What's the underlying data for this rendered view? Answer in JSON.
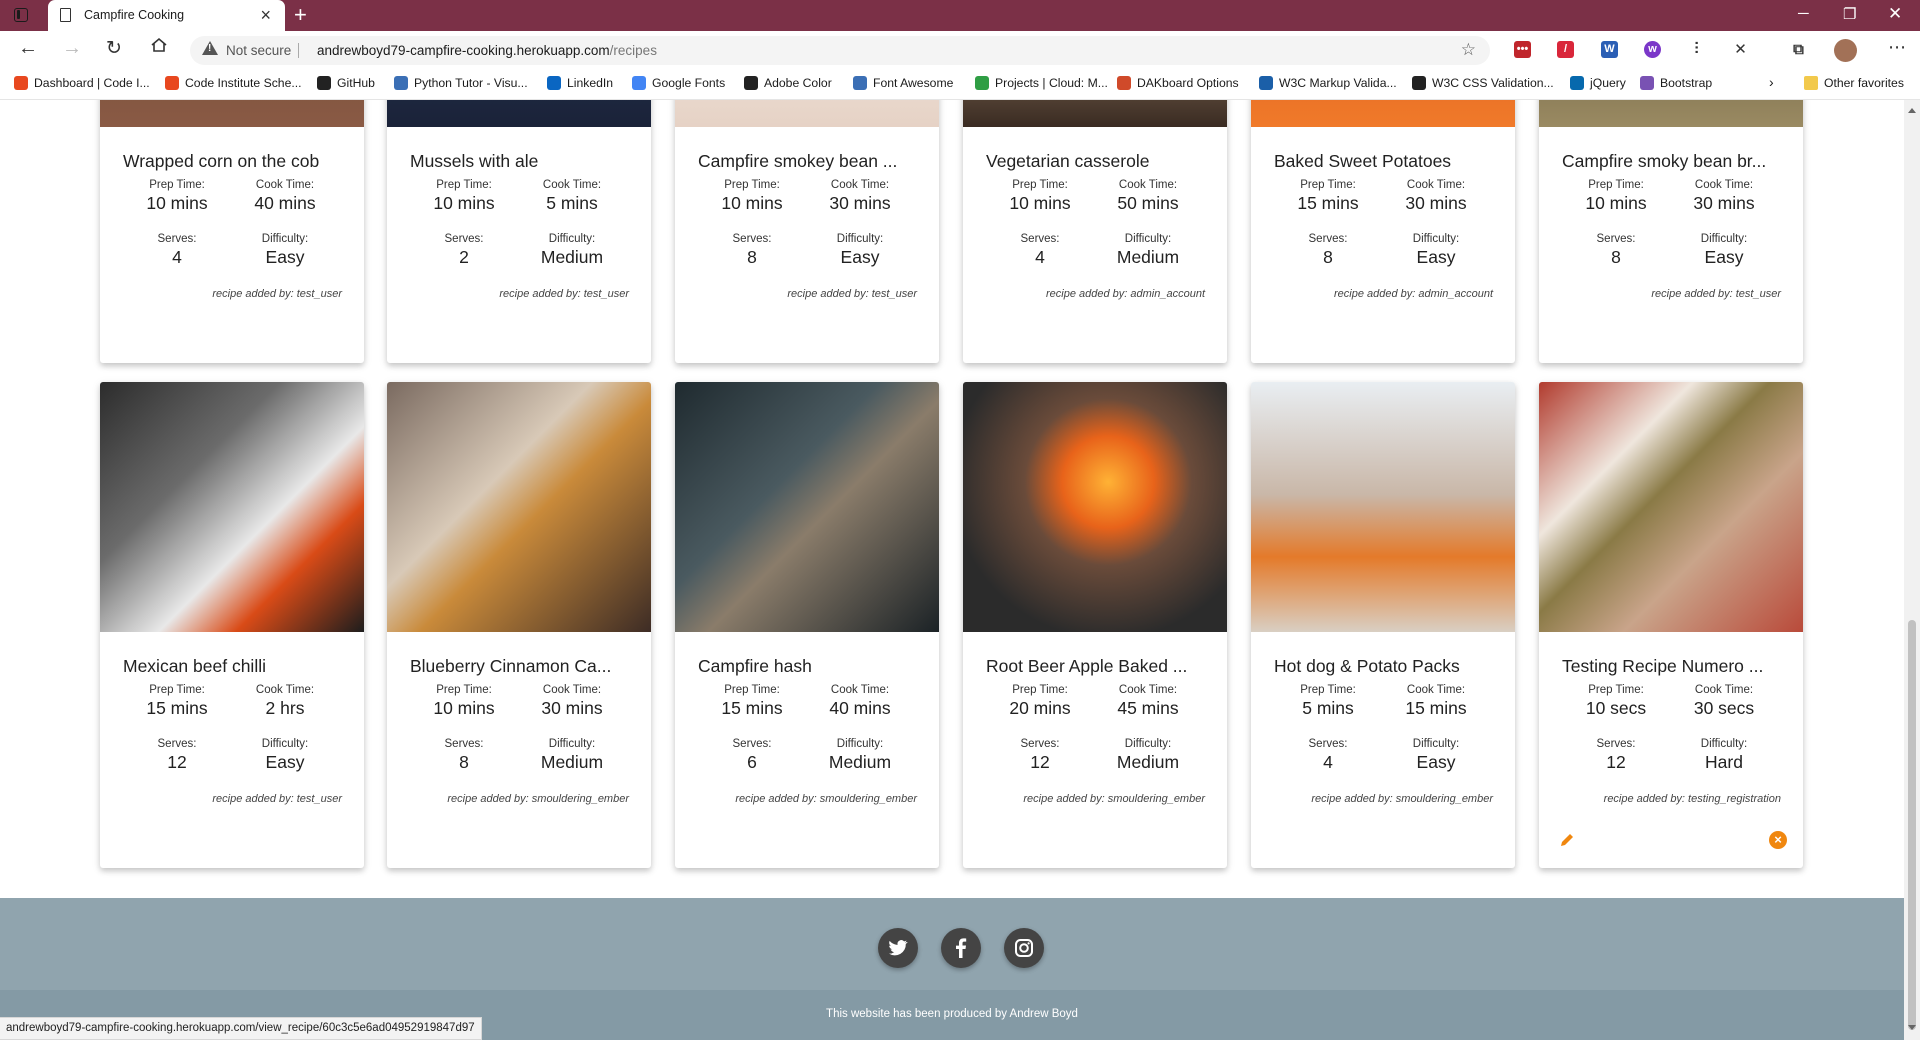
{
  "browser": {
    "tab_title": "Campfire Cooking",
    "not_secure": "Not secure",
    "url_host": "andrewboyd79-campfire-cooking.herokuapp.com",
    "url_path": "/recipes",
    "status_url": "andrewboyd79-campfire-cooking.herokuapp.com/view_recipe/60c3c5e6ad04952919847d97"
  },
  "bookmarks": [
    {
      "label": "Dashboard | Code I...",
      "color": "#e8481f"
    },
    {
      "label": "Code Institute Sche...",
      "color": "#e8481f"
    },
    {
      "label": "GitHub",
      "color": "#222222"
    },
    {
      "label": "Python Tutor - Visu...",
      "color": "#3b6fb5"
    },
    {
      "label": "LinkedIn",
      "color": "#0a66c2"
    },
    {
      "label": "Google Fonts",
      "color": "#4285f4"
    },
    {
      "label": "Adobe Color",
      "color": "#222222"
    },
    {
      "label": "Font Awesome",
      "color": "#3b6fb5"
    },
    {
      "label": "Projects | Cloud: M...",
      "color": "#2f9e44"
    },
    {
      "label": "DAKboard Options",
      "color": "#d04a2a"
    },
    {
      "label": "W3C Markup Valida...",
      "color": "#1b5fa8"
    },
    {
      "label": "W3C CSS Validation...",
      "color": "#222222"
    },
    {
      "label": "jQuery",
      "color": "#0769ad"
    },
    {
      "label": "Bootstrap",
      "color": "#7952b3"
    }
  ],
  "bookmarks_other": "Other favorites",
  "labels": {
    "prep": "Prep Time:",
    "cook": "Cook Time:",
    "serves": "Serves:",
    "difficulty": "Difficulty:"
  },
  "recipes_row1": [
    {
      "title": "Wrapped corn on the cob",
      "prep": "10 mins",
      "cook": "40 mins",
      "serves": "4",
      "difficulty": "Easy",
      "added_by": "recipe added by: test_user"
    },
    {
      "title": "Mussels with ale",
      "prep": "10 mins",
      "cook": "5 mins",
      "serves": "2",
      "difficulty": "Medium",
      "added_by": "recipe added by: test_user"
    },
    {
      "title": "Campfire smokey bean ...",
      "prep": "10 mins",
      "cook": "30 mins",
      "serves": "8",
      "difficulty": "Easy",
      "added_by": "recipe added by: test_user"
    },
    {
      "title": "Vegetarian casserole",
      "prep": "10 mins",
      "cook": "50 mins",
      "serves": "4",
      "difficulty": "Medium",
      "added_by": "recipe added by: admin_account"
    },
    {
      "title": "Baked Sweet Potatoes",
      "prep": "15 mins",
      "cook": "30 mins",
      "serves": "8",
      "difficulty": "Easy",
      "added_by": "recipe added by: admin_account"
    },
    {
      "title": "Campfire smoky bean br...",
      "prep": "10 mins",
      "cook": "30 mins",
      "serves": "8",
      "difficulty": "Easy",
      "added_by": "recipe added by: test_user"
    }
  ],
  "recipes_row2": [
    {
      "title": "Mexican beef chilli",
      "prep": "15 mins",
      "cook": "2 hrs",
      "serves": "12",
      "difficulty": "Easy",
      "added_by": "recipe added by: test_user"
    },
    {
      "title": "Blueberry Cinnamon Ca...",
      "prep": "10 mins",
      "cook": "30 mins",
      "serves": "8",
      "difficulty": "Medium",
      "added_by": "recipe added by: smouldering_ember"
    },
    {
      "title": "Campfire hash",
      "prep": "15 mins",
      "cook": "40 mins",
      "serves": "6",
      "difficulty": "Medium",
      "added_by": "recipe added by: smouldering_ember"
    },
    {
      "title": "Root Beer Apple Baked ...",
      "prep": "20 mins",
      "cook": "45 mins",
      "serves": "12",
      "difficulty": "Medium",
      "added_by": "recipe added by: smouldering_ember"
    },
    {
      "title": "Hot dog & Potato Packs",
      "prep": "5 mins",
      "cook": "15 mins",
      "serves": "4",
      "difficulty": "Easy",
      "added_by": "recipe added by: smouldering_ember"
    },
    {
      "title": "Testing Recipe Numero ...",
      "prep": "10 secs",
      "cook": "30 secs",
      "serves": "12",
      "difficulty": "Hard",
      "added_by": "recipe added by: testing_registration"
    }
  ],
  "footer": {
    "copyright": "This website has been produced by Andrew Boyd",
    "social": [
      "twitter-icon",
      "facebook-icon",
      "instagram-icon"
    ]
  }
}
